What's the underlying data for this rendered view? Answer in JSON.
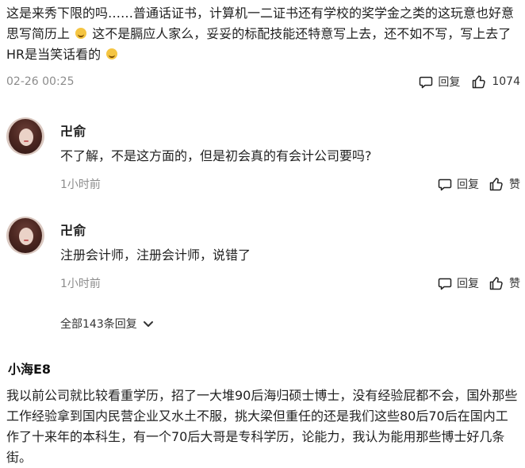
{
  "top_comment": {
    "text_parts": [
      "这是来秀下限的吗……普通话证书，计算机一二证书还有学校的奖学金之类的这玩意也好意思写简历上",
      "这不是膈应人家么，妥妥的标配技能还特意写上去，还不如不写，写上去了HR是当笑话看的"
    ],
    "emoji_names": [
      "laughing-emoji",
      "smiling-emoji"
    ],
    "time": "02-26 00:25",
    "reply_label": "回复",
    "like_count": "1074"
  },
  "replies": [
    {
      "name": "卍俞",
      "text": "不了解，不是这方面的，但是初会真的有会计公司要吗?",
      "time": "1小时前",
      "reply_label": "回复",
      "like_label": "赞"
    },
    {
      "name": "卍俞",
      "text": "注册会计师，注册会计师，说错了",
      "time": "1小时前",
      "reply_label": "回复",
      "like_label": "赞"
    }
  ],
  "all_replies": {
    "label": "全部143条回复"
  },
  "next_comment": {
    "name": "小海E8",
    "text": "我以前公司就比较看重学历，招了一大堆90后海归硕士博士，没有经验屁都不会，国外那些工作经验拿到国内民营企业又水土不服，挑大梁但重任的还是我们这些80后70后在国内工作了十来年的本科生，有一个70后大哥是专科学历，论能力，我认为能用那些博士好几条街。"
  },
  "colors": {
    "text": "#1f1f1f",
    "meta": "#8c8c8c",
    "background": "#ffffff",
    "emoji": "#f5c542"
  },
  "icons": [
    "comment-icon",
    "thumbs-up-icon",
    "chevron-down-icon"
  ]
}
